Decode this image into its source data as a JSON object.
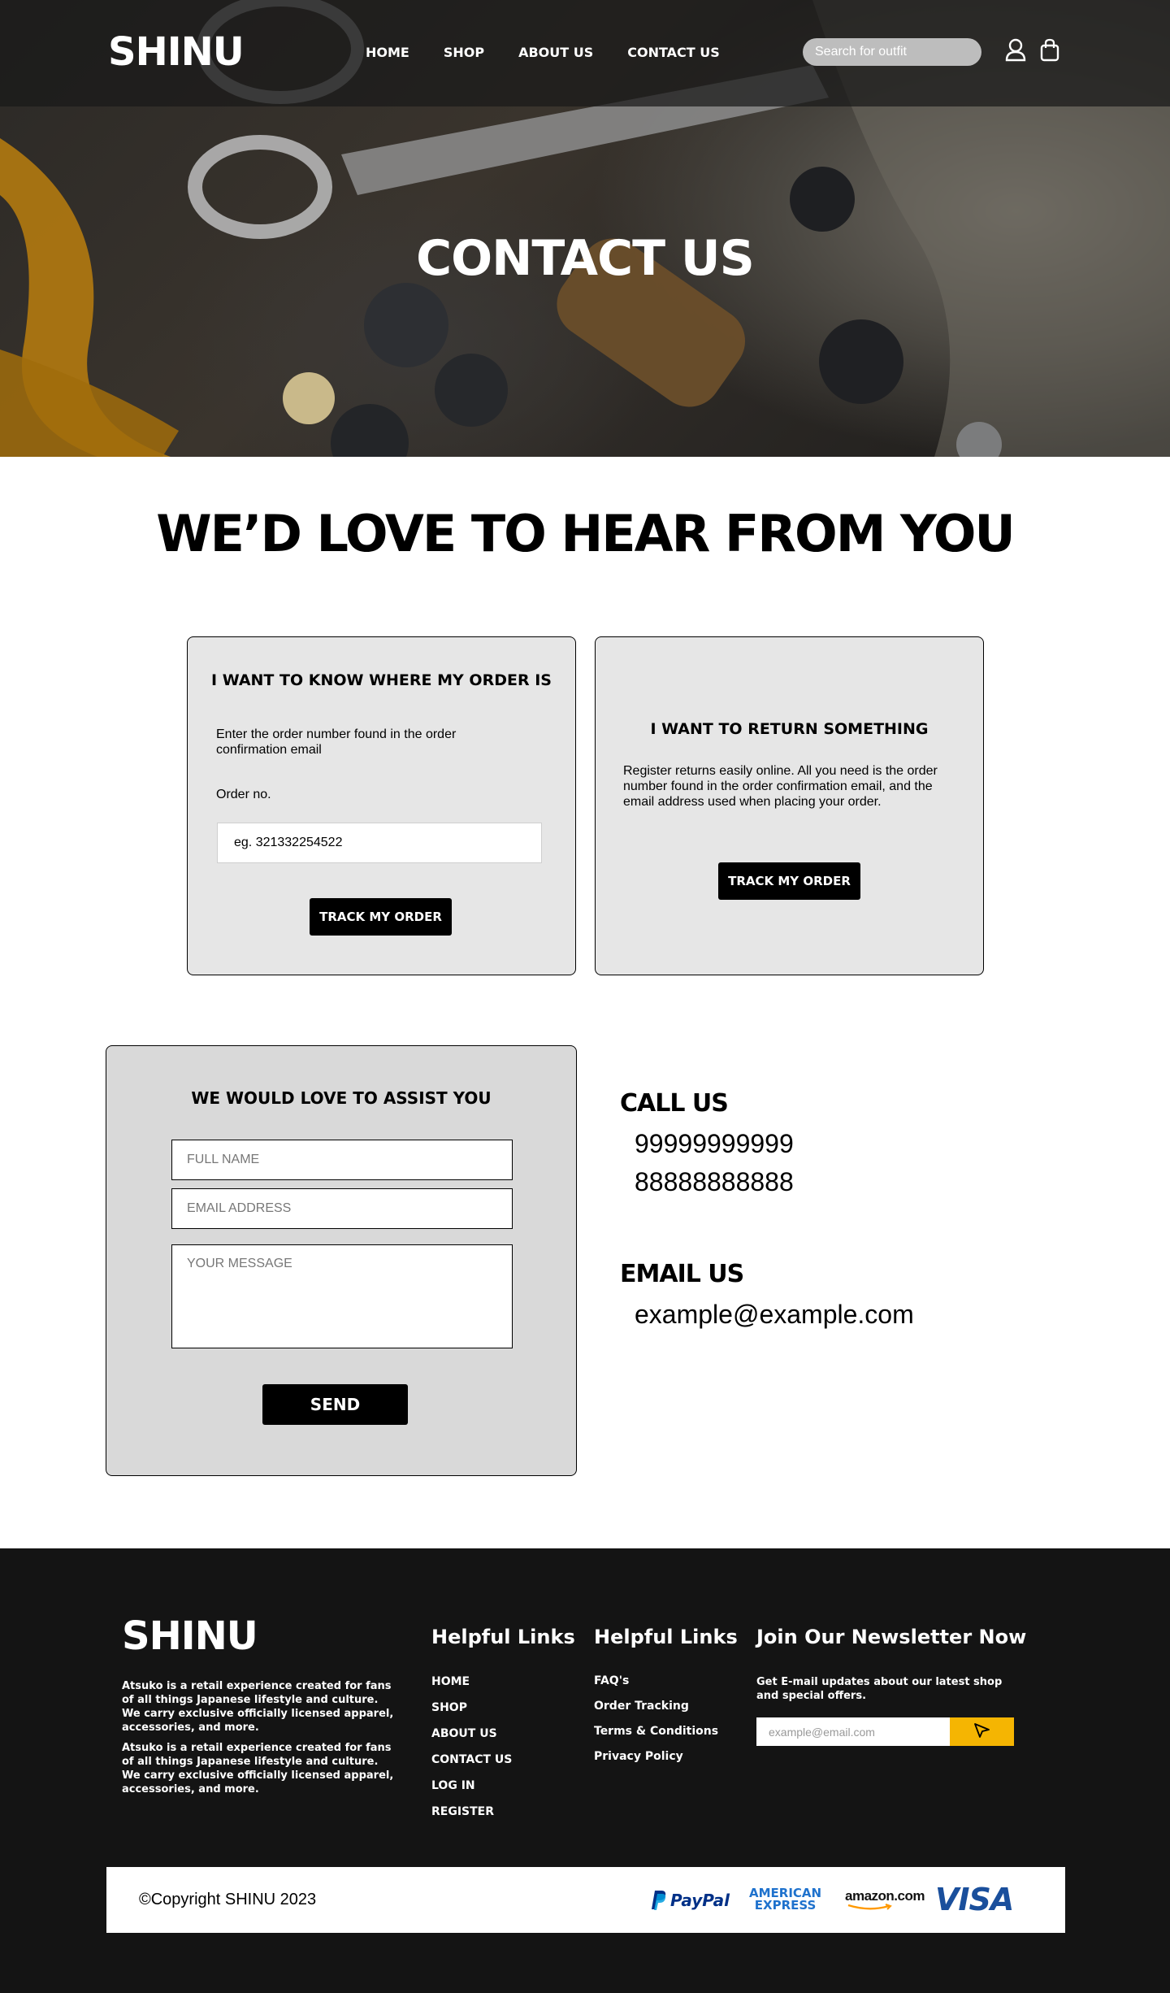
{
  "header": {
    "logo": "SHINU",
    "nav": [
      "HOME",
      "SHOP",
      "ABOUT US",
      "CONTACT US"
    ],
    "search_placeholder": "Search for outfit",
    "icons": [
      "user-icon",
      "shopping-bag-icon"
    ]
  },
  "hero": {
    "title": "CONTACT US"
  },
  "main": {
    "heading": "WE’D LOVE TO HEAR FROM YOU",
    "order_card": {
      "title": "I WANT TO KNOW WHERE MY ORDER IS",
      "description": "Enter the order number found in the order confirmation email",
      "field_label": "Order no.",
      "input_value": "eg. 321332254522",
      "button": "TRACK MY ORDER"
    },
    "return_card": {
      "title": "I WANT TO RETURN SOMETHING",
      "description": "Register returns easily online. All you need is the order number found in the order confirmation email, and the email address used when placing your order.",
      "button": "TRACK MY ORDER"
    },
    "assist_card": {
      "title": "WE WOULD LOVE TO ASSIST YOU",
      "name_placeholder": "FULL NAME",
      "email_placeholder": "EMAIL ADDRESS",
      "message_placeholder": "YOUR MESSAGE",
      "button": "SEND"
    },
    "call": {
      "heading": "CALL US",
      "numbers": [
        "99999999999",
        "88888888888"
      ]
    },
    "email": {
      "heading": "EMAIL US",
      "address": "example@example.com"
    }
  },
  "footer": {
    "logo": "SHINU",
    "about": [
      "Atsuko is a retail experience created for fans of all things Japanese lifestyle and culture. We carry exclusive officially licensed apparel, accessories, and more.",
      "Atsuko is a retail experience created for fans of all things Japanese lifestyle and culture. We carry exclusive officially licensed apparel, accessories, and more."
    ],
    "links_1": {
      "heading": "Helpful Links",
      "items": [
        "HOME",
        "SHOP",
        "ABOUT US",
        "CONTACT US",
        "LOG IN",
        "REGISTER"
      ]
    },
    "links_2": {
      "heading": "Helpful Links",
      "items": [
        "FAQ's",
        "Order Tracking",
        "Terms & Conditions",
        "Privacy Policy"
      ]
    },
    "newsletter": {
      "heading": "Join Our Newsletter Now",
      "text": "Get E-mail updates about our latest shop and special offers.",
      "email_placeholder": "example@email.com"
    },
    "copyright": "©Copyright SHINU 2023",
    "payments": {
      "paypal": "PayPal",
      "amex_1": "AMERICAN",
      "amex_2": "EXPRESS",
      "amazon": "amazon.com",
      "visa": "VISA"
    }
  },
  "colors": {
    "accent": "#f5b502",
    "footer_bg": "#141414",
    "card_bg": "#e6e6e6"
  }
}
